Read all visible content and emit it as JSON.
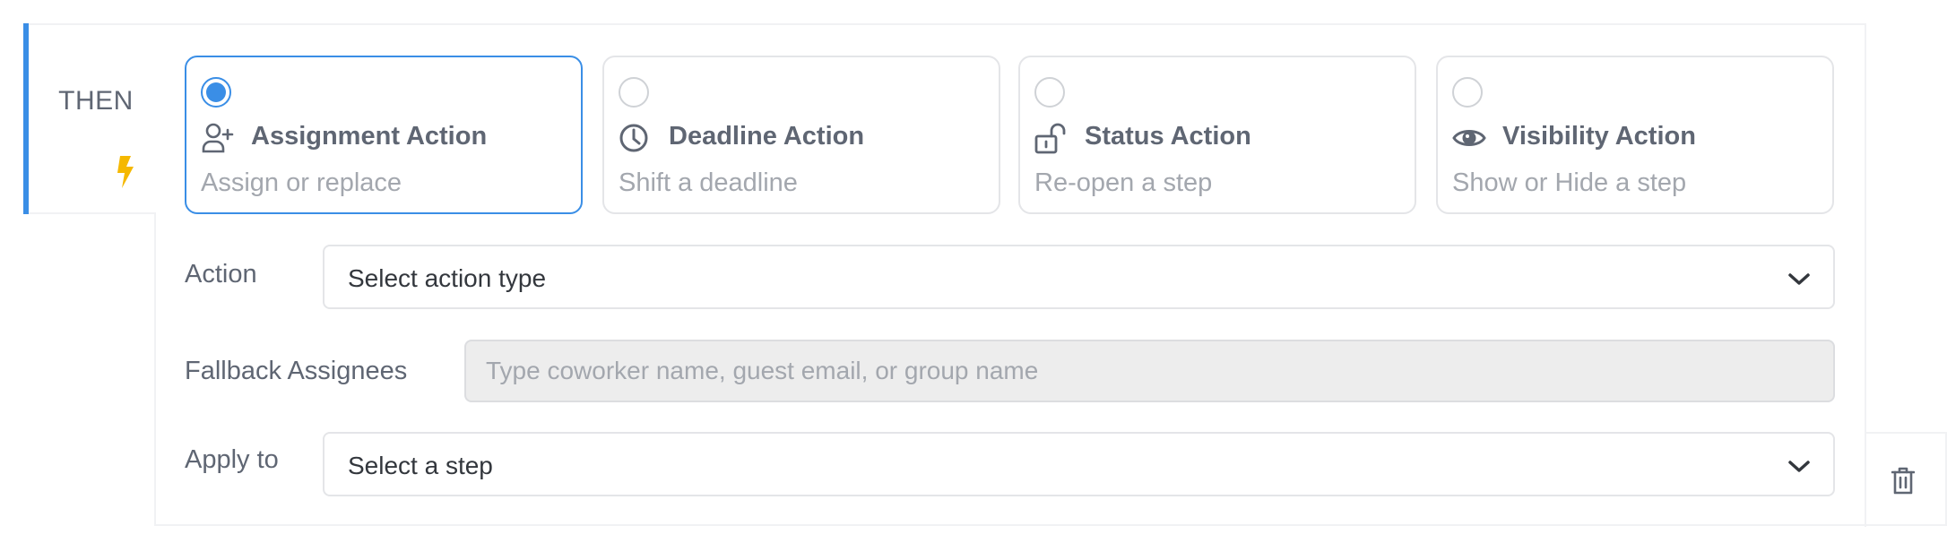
{
  "section": {
    "label": "THEN",
    "icon": "lightning-bolt-icon",
    "accent_color": "#3a8ee6",
    "bolt_color": "#f5b800"
  },
  "action_types": [
    {
      "id": "assignment",
      "title": "Assignment Action",
      "description": "Assign or replace",
      "icon": "user-plus-icon",
      "selected": true
    },
    {
      "id": "deadline",
      "title": "Deadline Action",
      "description": "Shift a deadline",
      "icon": "clock-icon",
      "selected": false
    },
    {
      "id": "status",
      "title": "Status Action",
      "description": "Re-open a step",
      "icon": "unlock-icon",
      "selected": false
    },
    {
      "id": "visibility",
      "title": "Visibility Action",
      "description": "Show or Hide a step",
      "icon": "eye-icon",
      "selected": false
    }
  ],
  "form": {
    "action": {
      "label": "Action",
      "value": "Select action type"
    },
    "fallback_assignees": {
      "label": "Fallback Assignees",
      "value": "",
      "placeholder": "Type coworker name, guest email, or group name"
    },
    "apply_to": {
      "label": "Apply to",
      "value": "Select a step"
    }
  },
  "delete": {
    "icon": "trash-icon"
  }
}
